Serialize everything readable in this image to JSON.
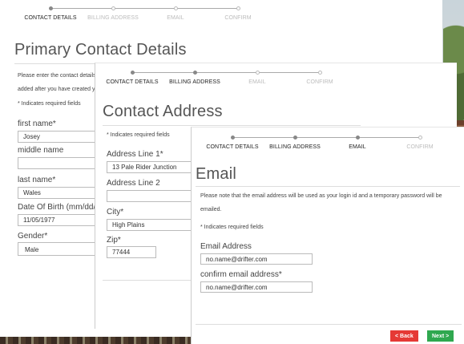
{
  "steps": [
    "CONTACT DETAILS",
    "BILLING ADDRESS",
    "EMAIL",
    "CONFIRM"
  ],
  "primary": {
    "title": "Primary Contact Details",
    "note_line1": "Please enter the contact details",
    "note_line2": "added after you have created y",
    "required_note": "* Indicates required fields",
    "first_name_label": "first name*",
    "first_name_value": "Josey",
    "middle_name_label": "middle name",
    "middle_name_value": "",
    "last_name_label": "last name*",
    "last_name_value": "Wales",
    "dob_label": "Date Of Birth (mm/dd/yy",
    "dob_value": "11/05/1977",
    "gender_label": "Gender*",
    "gender_value": "Male"
  },
  "address": {
    "title": "Contact Address",
    "required_note": "* Indicates required fields",
    "line1_label": "Address Line 1*",
    "line1_value": "13 Pale Rider Junction",
    "line2_label": "Address Line 2",
    "line2_value": "",
    "city_label": "City*",
    "city_value": "High Plains",
    "zip_label": "Zip*",
    "zip_value": "77444"
  },
  "email": {
    "title": "Email",
    "note": "Please note that the email address will be used as your login id and a temporary password will be emailed.",
    "required_note": "* Indicates required fields",
    "email_label": "Email Address",
    "email_value": "no.name@drifter.com",
    "confirm_label": "confirm email address*",
    "confirm_value": "no.name@drifter.com",
    "back_label": "< Back",
    "next_label": "Next >"
  },
  "colors": {
    "back": "#e53935",
    "next": "#2fa84f"
  }
}
